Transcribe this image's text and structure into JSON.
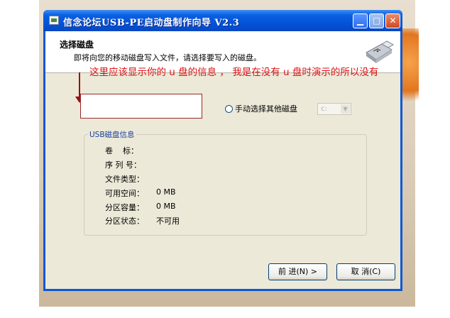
{
  "window": {
    "title": "信念论坛USB-PE启动盘制作向导 V2.3",
    "controls": [
      "minimize-icon",
      "maximize-icon",
      "close-icon"
    ]
  },
  "header": {
    "title": "选择磁盘",
    "subtitle": "即将向您的移动磁盘写入文件，请选择要写入的磁盘。",
    "icon": "usb-drive-icon"
  },
  "annotation": {
    "text": "这里应该显示你的 u 盘的信息 ， 我是在没有 u 盘时演示的所以没有",
    "color": "#e01010"
  },
  "disk_selection": {
    "radio_label": "手动选择其他磁盘",
    "drive_value": "c:"
  },
  "usb_info": {
    "group_title": "USB磁盘信息",
    "rows": [
      {
        "label": "卷    标：",
        "value": ""
      },
      {
        "label": "序 列 号：",
        "value": ""
      },
      {
        "label": "文件类型：",
        "value": ""
      },
      {
        "label": "可用空间：",
        "value": "0 MB"
      },
      {
        "label": "分区容量：",
        "value": "0 MB"
      },
      {
        "label": "分区状态：",
        "value": "不可用"
      }
    ]
  },
  "buttons": {
    "next": "前 进(N) >",
    "cancel": "取 消(C)"
  },
  "colors": {
    "titlebar": "#0351d6",
    "dialog_bg": "#ece9d8",
    "annotation": "#e01010"
  }
}
